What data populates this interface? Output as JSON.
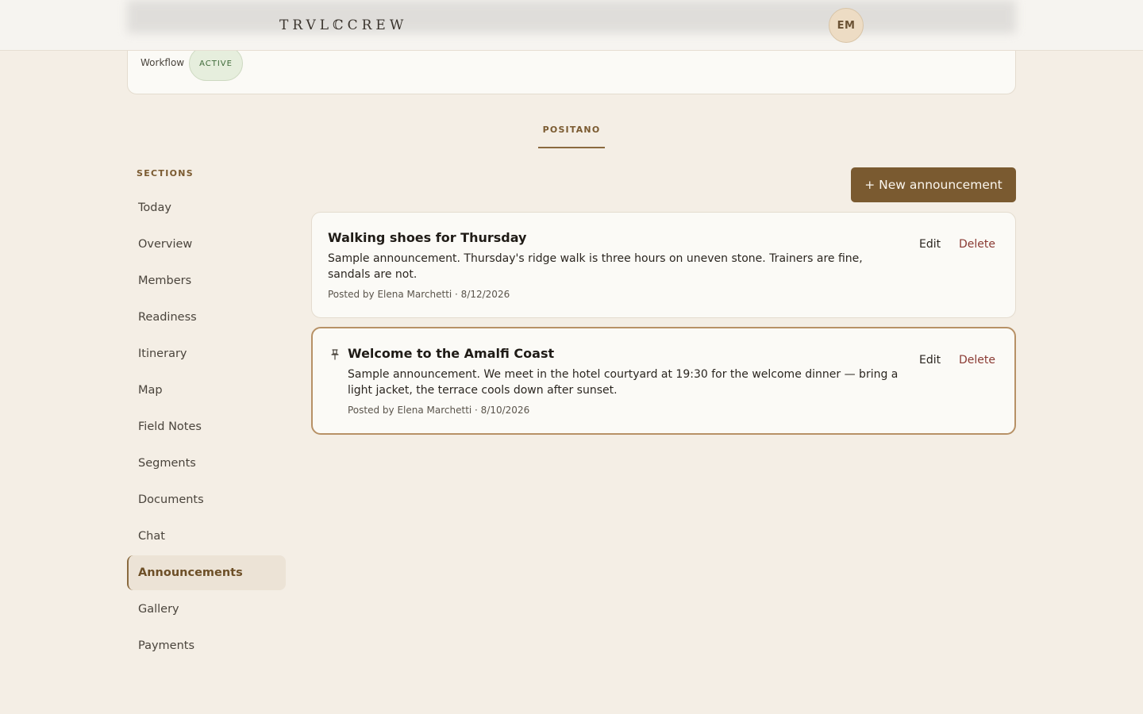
{
  "header": {
    "logo": "TRVLℂCREW",
    "avatar_initials": "EM"
  },
  "workflow": {
    "label": "Workflow",
    "status": "ACTIVE"
  },
  "tabs": [
    {
      "label": "POSITANO",
      "active": true
    }
  ],
  "sidebar": {
    "heading": "SECTIONS",
    "items": [
      {
        "label": "Today"
      },
      {
        "label": "Overview"
      },
      {
        "label": "Members"
      },
      {
        "label": "Readiness"
      },
      {
        "label": "Itinerary"
      },
      {
        "label": "Map"
      },
      {
        "label": "Field Notes"
      },
      {
        "label": "Segments"
      },
      {
        "label": "Documents"
      },
      {
        "label": "Chat"
      },
      {
        "label": "Announcements",
        "active": true
      },
      {
        "label": "Gallery"
      },
      {
        "label": "Payments"
      }
    ]
  },
  "actions": {
    "new_announcement": "+ New announcement"
  },
  "announcements": [
    {
      "title": "Walking shoes for Thursday",
      "body": "Sample announcement. Thursday's ridge walk is three hours on uneven stone. Trainers are fine, sandals are not.",
      "meta": "Posted by Elena Marchetti · 8/12/2026",
      "pinned": false,
      "edit_label": "Edit",
      "delete_label": "Delete"
    },
    {
      "title": "Welcome to the Amalfi Coast",
      "body": "Sample announcement. We meet in the hotel courtyard at 19:30 for the welcome dinner — bring a light jacket, the terrace cools down after sunset.",
      "meta": "Posted by Elena Marchetti · 8/10/2026",
      "pinned": true,
      "edit_label": "Edit",
      "delete_label": "Delete"
    }
  ],
  "colors": {
    "background": "#f4eee5",
    "accent": "#7a5a30",
    "active_status": "#3f6a39",
    "delete": "#8a3a33"
  },
  "icons": {
    "pinned": "pin-icon"
  }
}
